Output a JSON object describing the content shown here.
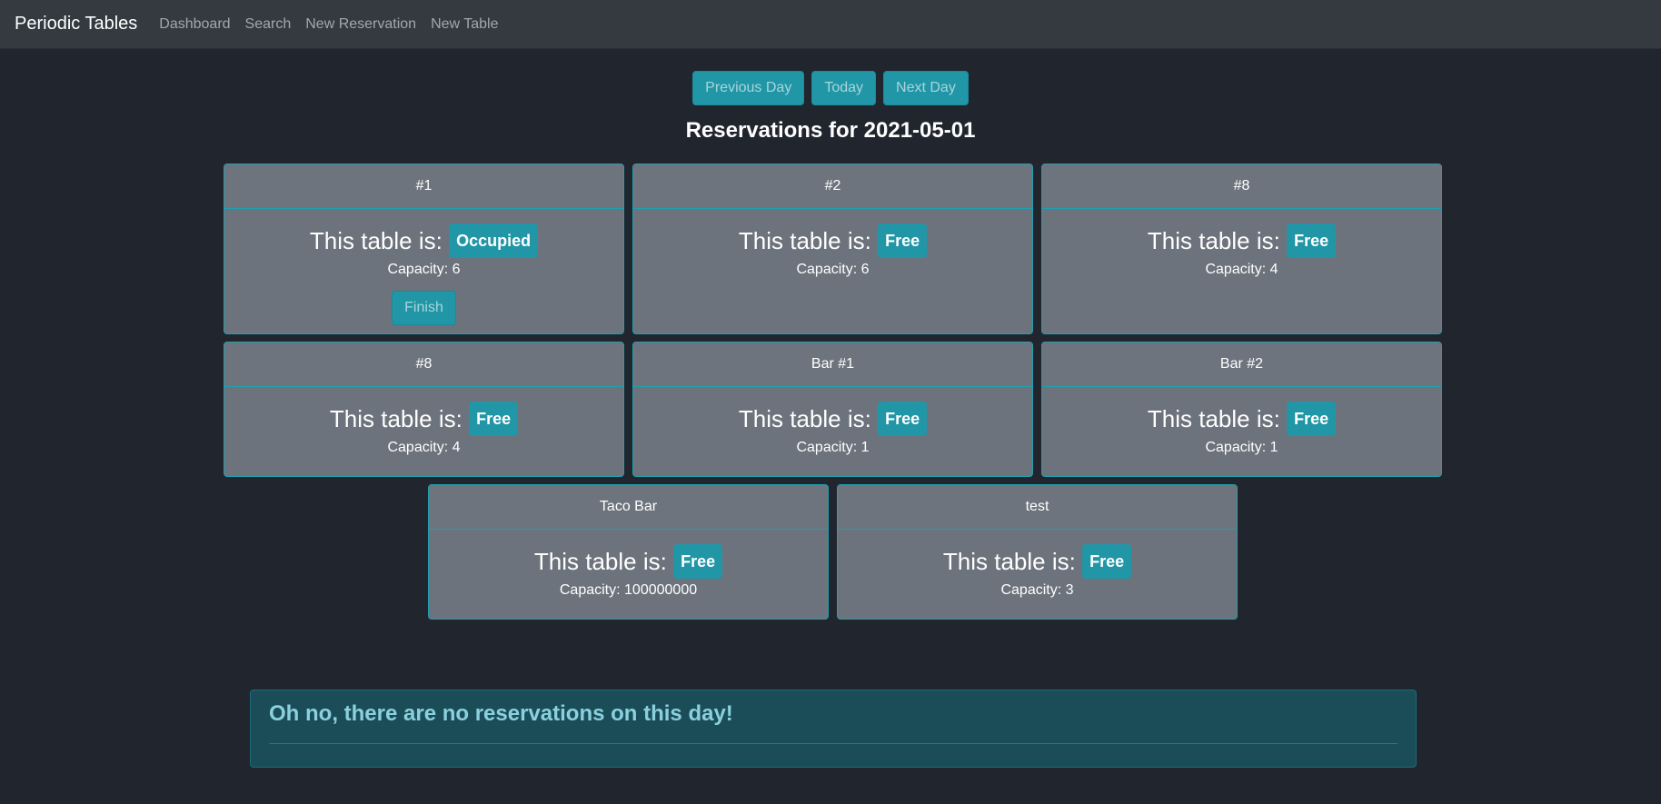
{
  "nav": {
    "brand": "Periodic Tables",
    "links": [
      "Dashboard",
      "Search",
      "New Reservation",
      "New Table"
    ]
  },
  "controls": {
    "previous_day": "Previous Day",
    "today": "Today",
    "next_day": "Next Day"
  },
  "heading": "Reservations for 2021-05-01",
  "status_prefix": "This table is:",
  "capacity_prefix": "Capacity:",
  "tables": [
    {
      "name": "#1",
      "status": "Occupied",
      "capacity": "6",
      "action": "Finish"
    },
    {
      "name": "#2",
      "status": "Free",
      "capacity": "6"
    },
    {
      "name": "#8",
      "status": "Free",
      "capacity": "4"
    },
    {
      "name": "#8",
      "status": "Free",
      "capacity": "4"
    },
    {
      "name": "Bar #1",
      "status": "Free",
      "capacity": "1"
    },
    {
      "name": "Bar #2",
      "status": "Free",
      "capacity": "1"
    },
    {
      "name": "Taco Bar",
      "status": "Free",
      "capacity": "100000000"
    },
    {
      "name": "test",
      "status": "Free",
      "capacity": "3"
    }
  ],
  "alert": {
    "message": "Oh no, there are no reservations on this day!"
  },
  "colors": {
    "background": "#20252e",
    "navbar": "#343a40",
    "accent": "#2196a6",
    "card": "#6c737c",
    "alert_bg": "#1b4d59",
    "alert_text": "#8ad0dd"
  }
}
